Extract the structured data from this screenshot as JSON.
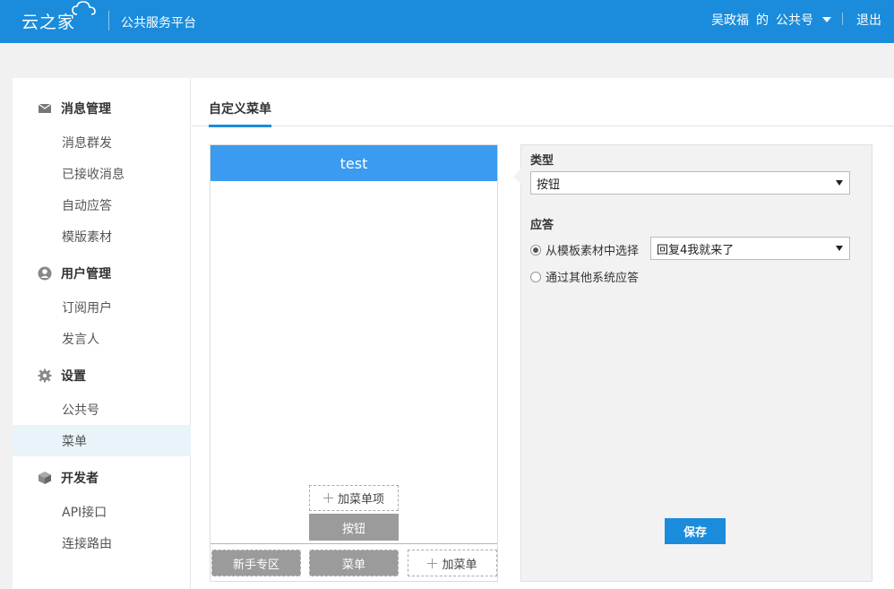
{
  "header": {
    "logo_text": "云之家",
    "platform_name": "公共服务平台",
    "user_name": "吴政福",
    "user_of": "的",
    "account_label": "公共号",
    "logout_label": "退出",
    "bg_color": "#1a8cdb"
  },
  "sidebar": {
    "groups": [
      {
        "label": "消息管理",
        "icon": "inbox-icon",
        "items": [
          "消息群发",
          "已接收消息",
          "自动应答",
          "模版素材"
        ]
      },
      {
        "label": "用户管理",
        "icon": "user-icon",
        "items": [
          "订阅用户",
          "发言人"
        ]
      },
      {
        "label": "设置",
        "icon": "gear-icon",
        "items": [
          "公共号",
          "菜单"
        ]
      },
      {
        "label": "开发者",
        "icon": "cube-icon",
        "items": [
          "API接口",
          "连接路由"
        ]
      }
    ],
    "active_item": "菜单"
  },
  "tabs": {
    "active": "自定义菜单"
  },
  "preview": {
    "title": "test",
    "add_sub_label": "加菜单项",
    "sub_button_label": "按钮",
    "menus": [
      "新手专区",
      "菜单"
    ],
    "add_menu_label": "加菜单"
  },
  "panel": {
    "type_label": "类型",
    "type_value": "按钮",
    "reply_label": "应答",
    "option_template": "从模板素材中选择",
    "template_value": "回复4我就来了",
    "option_other": "通过其他系统应答",
    "selected_option": "template",
    "save_label": "保存"
  }
}
